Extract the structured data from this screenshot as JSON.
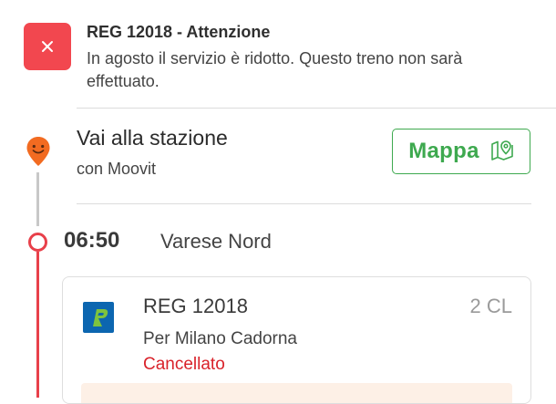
{
  "alert": {
    "title": "REG 12018 - Attenzione",
    "message": "In agosto il servizio è ridotto. Questo treno non sarà effettuato.",
    "icon": "close-icon"
  },
  "directions": {
    "title": "Vai alla stazione",
    "subtitle": "con Moovit",
    "map_button_label": "Mappa",
    "map_button_icon": "map-pin-icon",
    "pin_icon": "moovit-smile-pin-icon"
  },
  "departure": {
    "time": "06:50",
    "station": "Varese Nord"
  },
  "train": {
    "name": "REG 12018",
    "class": "2 CL",
    "destination": "Per Milano Cadorna",
    "status": "Cancellato",
    "operator_logo": "trenord-logo-icon"
  },
  "colors": {
    "alert_red": "#f2474f",
    "route_red": "#e8404a",
    "accent_green": "#3ea94f",
    "moovit_orange": "#f26b21",
    "status_red": "#d9222a",
    "logo_blue": "#0c66b0",
    "logo_green": "#7ec33e"
  }
}
